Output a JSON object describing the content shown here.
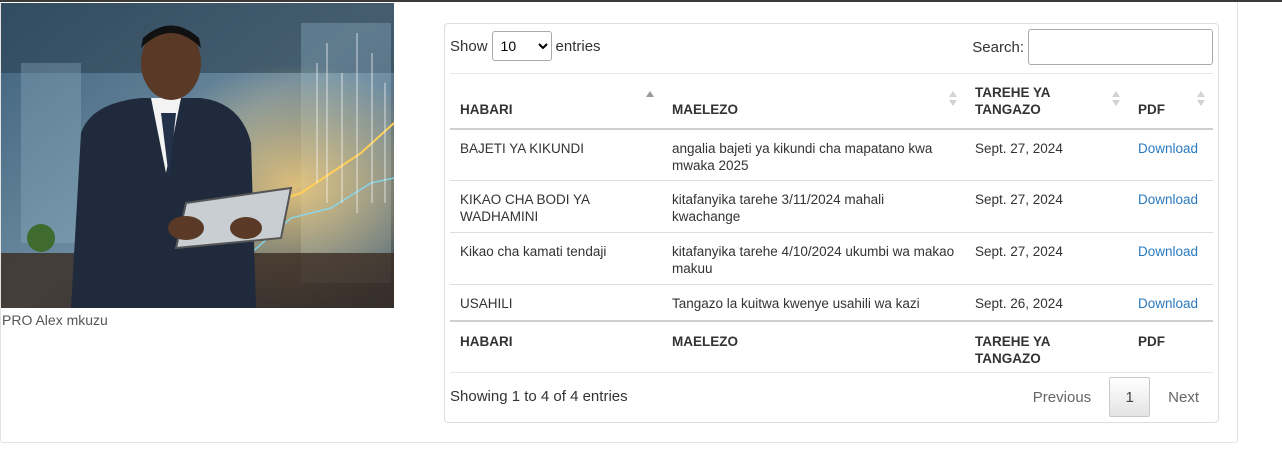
{
  "photo": {
    "caption": "PRO Alex mkuzu"
  },
  "table": {
    "length": {
      "show_label": "Show",
      "entries_label": "entries",
      "selected": "10"
    },
    "search": {
      "label": "Search:",
      "value": "",
      "placeholder": ""
    },
    "headers": [
      "HABARI",
      "MAELEZO",
      "TAREHE YA TANGAZO",
      "PDF"
    ],
    "rows": [
      {
        "habari": "BAJETI YA KIKUNDI",
        "maelezo": "angalia bajeti ya kikundi cha mapatano kwa mwaka 2025",
        "tarehe": "Sept. 27, 2024",
        "pdf": "Download"
      },
      {
        "habari": "KIKAO CHA BODI YA WADHAMINI",
        "maelezo": "kitafanyika tarehe 3/11/2024 mahali kwachange",
        "tarehe": "Sept. 27, 2024",
        "pdf": "Download"
      },
      {
        "habari": "Kikao cha kamati tendaji",
        "maelezo": "kitafanyika tarehe 4/10/2024 ukumbi wa makao makuu",
        "tarehe": "Sept. 27, 2024",
        "pdf": "Download"
      },
      {
        "habari": "USAHILI",
        "maelezo": "Tangazo la kuitwa kwenye usahili wa kazi",
        "tarehe": "Sept. 26, 2024",
        "pdf": "Download"
      }
    ],
    "info": "Showing 1 to 4 of 4 entries",
    "pagination": {
      "previous": "Previous",
      "current": "1",
      "next": "Next"
    }
  },
  "colors": {
    "link": "#2a7ac0",
    "border": "#dddddd"
  }
}
